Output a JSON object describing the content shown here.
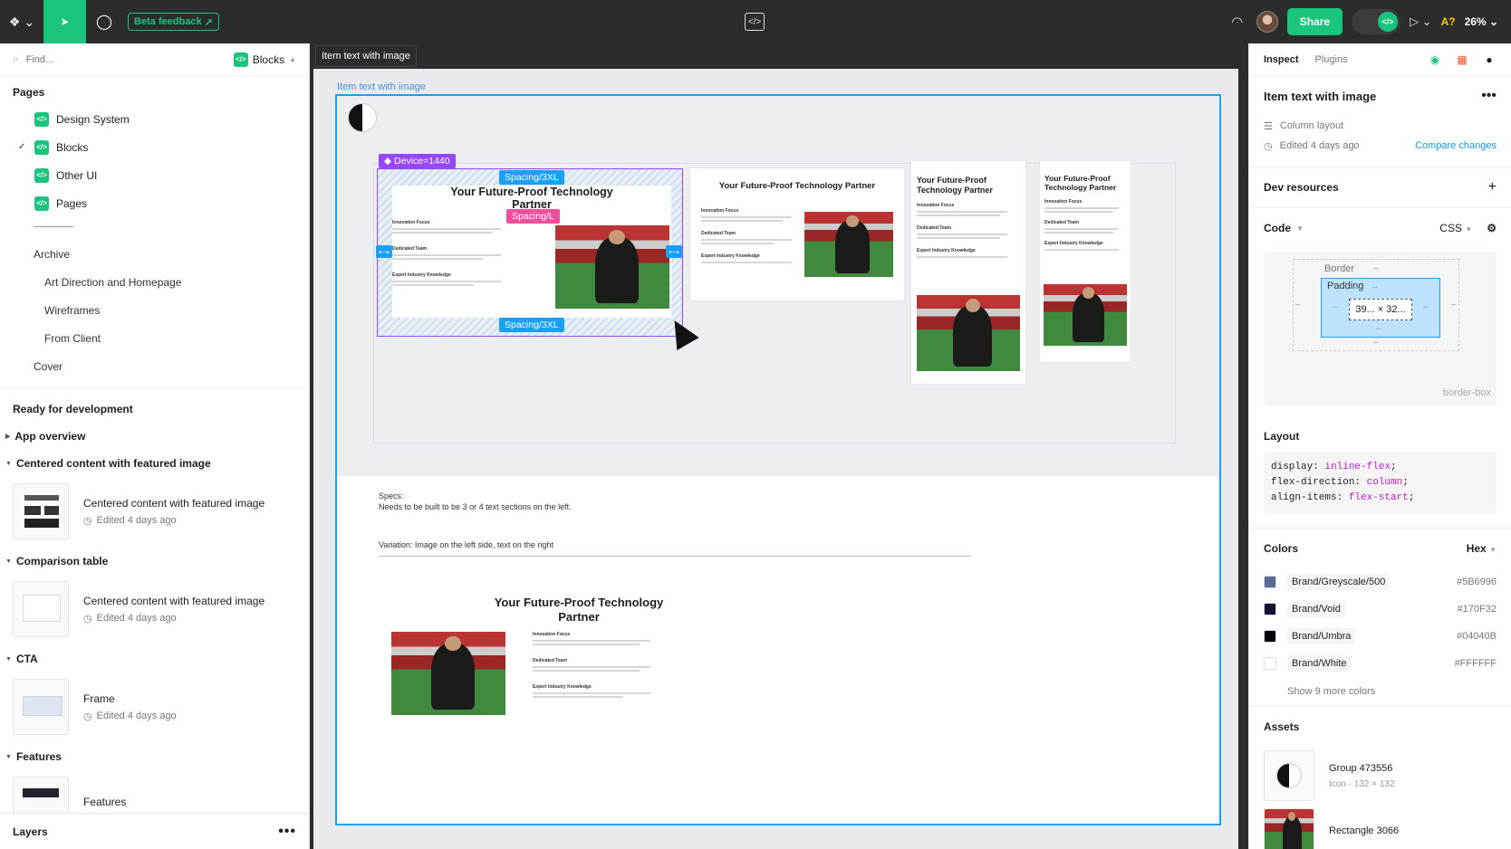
{
  "topbar": {
    "beta_feedback": "Beta feedback",
    "share": "Share",
    "avatar_initial": "A?",
    "zoom": "26%"
  },
  "left": {
    "search_placeholder": "Find...",
    "file_selector": "Blocks",
    "pages_title": "Pages",
    "pages": [
      {
        "label": "Design System"
      },
      {
        "label": "Blocks"
      },
      {
        "label": "Other UI"
      },
      {
        "label": "Pages"
      }
    ],
    "divider_text": "———",
    "archive": "Archive",
    "archive_items": [
      "Art Direction and Homepage",
      "Wireframes",
      "From Client"
    ],
    "cover": "Cover",
    "ready_title": "Ready for development",
    "groups": [
      {
        "title": "App overview"
      },
      {
        "title": "Centered content with featured image",
        "card_title": "Centered content with featured image",
        "card_meta": "Edited 4 days ago"
      },
      {
        "title": "Comparison table",
        "card_title": "Centered content with featured image",
        "card_meta": "Edited 4 days ago"
      },
      {
        "title": "CTA",
        "card_title": "Frame",
        "card_meta": "Edited 4 days ago"
      },
      {
        "title": "Features",
        "card_title": "Features"
      }
    ],
    "layers": "Layers"
  },
  "canvas": {
    "frame_tab": "Item text with image",
    "frame_label": "Item text with image",
    "device_tag": "Device=1440",
    "spacing_top": "Spacing/3XL",
    "spacing_mid": "Spacing/L",
    "spacing_bottom": "Spacing/3XL",
    "block_title": "Your Future-Proof Technology Partner",
    "innovation": "Innovation Focus",
    "dedicated": "Dedicated Team",
    "expert": "Expert Industry Knowledge",
    "specs_label": "Specs:",
    "specs_text": "Needs to be built to be 3 or 4 text sections on the left.",
    "variation": "Variation: Image on the left side, text on the right"
  },
  "right": {
    "tabs": [
      "Inspect",
      "Plugins"
    ],
    "title": "Item text with image",
    "layout_type": "Column layout",
    "edited": "Edited 4 days ago",
    "compare": "Compare changes",
    "dev_resources": "Dev resources",
    "code_title": "Code",
    "code_lang": "CSS",
    "box": {
      "border": "Border",
      "padding": "Padding",
      "content": "39... × 32...",
      "sizing": "border-box"
    },
    "layout_title": "Layout",
    "layout_code": [
      {
        "prop": "display: ",
        "val": "inline-flex"
      },
      {
        "prop": "flex-direction: ",
        "val": "column"
      },
      {
        "prop": "align-items: ",
        "val": "flex-start"
      }
    ],
    "colors_title": "Colors",
    "colors_format": "Hex",
    "colors": [
      {
        "name": "Brand/Greyscale/500",
        "hex": "#5B6996"
      },
      {
        "name": "Brand/Void",
        "hex": "#170F32"
      },
      {
        "name": "Brand/Umbra",
        "hex": "#04040B"
      },
      {
        "name": "Brand/White",
        "hex": "#FFFFFF"
      }
    ],
    "show_more": "Show 9 more colors",
    "assets_title": "Assets",
    "assets": [
      {
        "name": "Group 473556",
        "sub": "Icon · 132 × 132"
      },
      {
        "name": "Rectangle 3066",
        "sub": ""
      }
    ]
  }
}
